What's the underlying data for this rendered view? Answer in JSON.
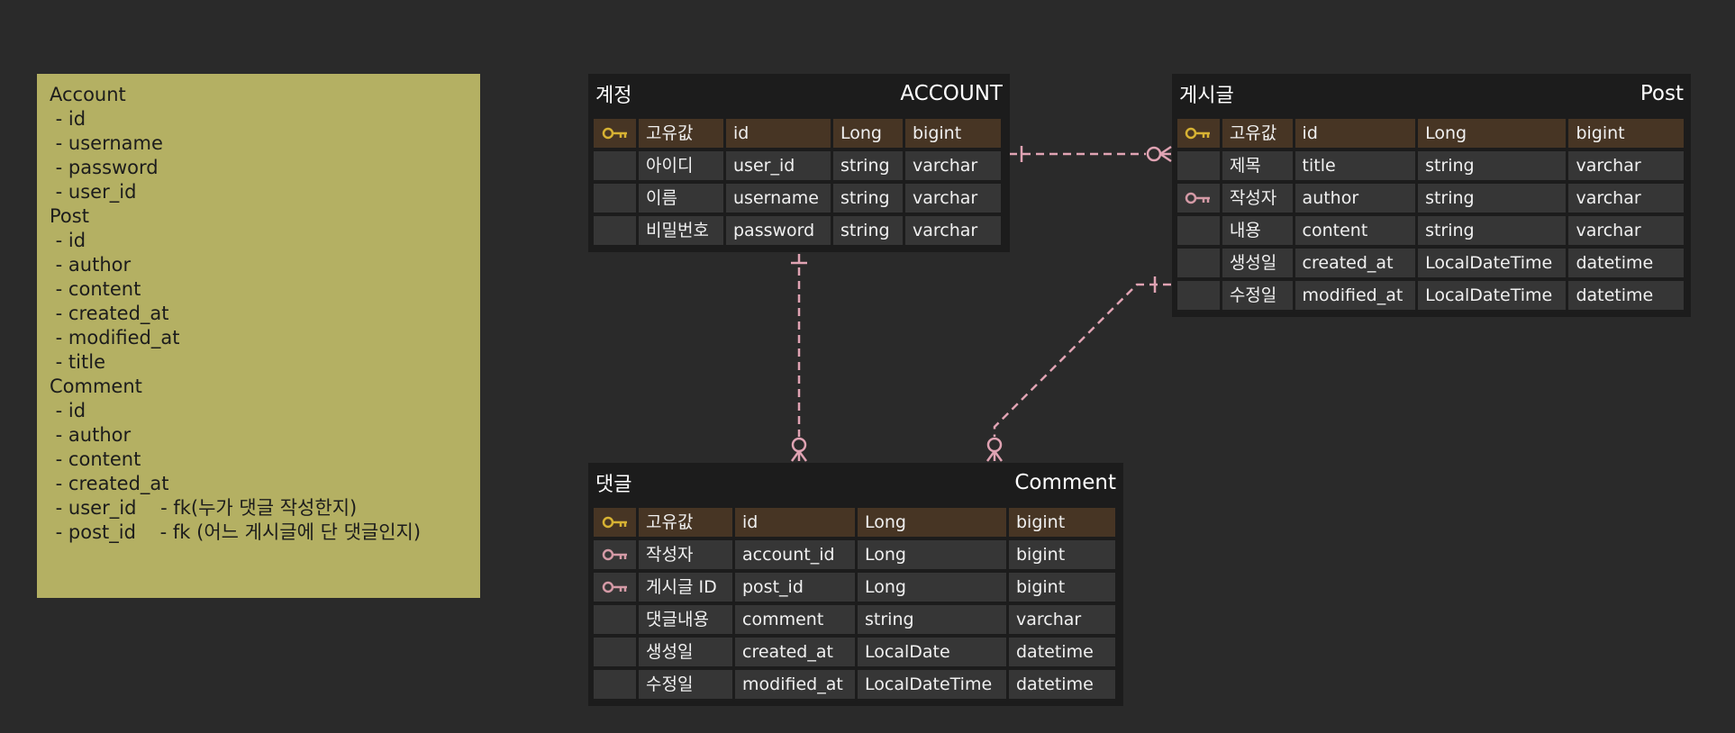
{
  "note": {
    "lines": [
      "Account",
      " - id",
      " - username",
      " - password",
      " - user_id",
      "Post",
      " - id",
      " - author",
      " - content",
      " - created_at",
      " - modified_at",
      " - title",
      "Comment",
      " - id",
      " - author",
      " - content",
      " - created_at",
      " - user_id    - fk(누가 댓글 작성한지)",
      " - post_id    - fk (어느 게시글에 단 댓글인지)"
    ]
  },
  "entities": {
    "account": {
      "label_ko": "계정",
      "label_en": "ACCOUNT",
      "rows": [
        {
          "key": "pk-icon",
          "ko": "고유값",
          "name": "id",
          "type": "Long",
          "db": "bigint"
        },
        {
          "key": "",
          "ko": "아이디",
          "name": "user_id",
          "type": "string",
          "db": "varchar"
        },
        {
          "key": "",
          "ko": "이름",
          "name": "username",
          "type": "string",
          "db": "varchar"
        },
        {
          "key": "",
          "ko": "비밀번호",
          "name": "password",
          "type": "string",
          "db": "varchar"
        }
      ]
    },
    "post": {
      "label_ko": "게시글",
      "label_en": "Post",
      "rows": [
        {
          "key": "pk-icon",
          "ko": "고유값",
          "name": "id",
          "type": "Long",
          "db": "bigint"
        },
        {
          "key": "",
          "ko": "제목",
          "name": "title",
          "type": "string",
          "db": "varchar"
        },
        {
          "key": "fk-icon",
          "ko": "작성자",
          "name": "author",
          "type": "string",
          "db": "varchar"
        },
        {
          "key": "",
          "ko": "내용",
          "name": "content",
          "type": "string",
          "db": "varchar"
        },
        {
          "key": "",
          "ko": "생성일",
          "name": "created_at",
          "type": "LocalDateTime",
          "db": "datetime"
        },
        {
          "key": "",
          "ko": "수정일",
          "name": "modified_at",
          "type": "LocalDateTime",
          "db": "datetime"
        }
      ]
    },
    "comment": {
      "label_ko": "댓글",
      "label_en": "Comment",
      "rows": [
        {
          "key": "pk-icon",
          "ko": "고유값",
          "name": "id",
          "type": "Long",
          "db": "bigint"
        },
        {
          "key": "fk-icon",
          "ko": "작성자",
          "name": "account_id",
          "type": "Long",
          "db": "bigint"
        },
        {
          "key": "fk-icon",
          "ko": "게시글 ID",
          "name": "post_id",
          "type": "Long",
          "db": "bigint"
        },
        {
          "key": "",
          "ko": "댓글내용",
          "name": "comment",
          "type": "string",
          "db": "varchar"
        },
        {
          "key": "",
          "ko": "생성일",
          "name": "created_at",
          "type": "LocalDate",
          "db": "datetime"
        },
        {
          "key": "",
          "ko": "수정일",
          "name": "modified_at",
          "type": "LocalDateTime",
          "db": "datetime"
        }
      ]
    }
  },
  "colors": {
    "background": "#2a2a2a",
    "note": "#b4b063",
    "pk_row": "#473524",
    "pk_key": "#d7b233",
    "fk_key": "#d49aa6",
    "relation_line": "#e0a3b3"
  }
}
